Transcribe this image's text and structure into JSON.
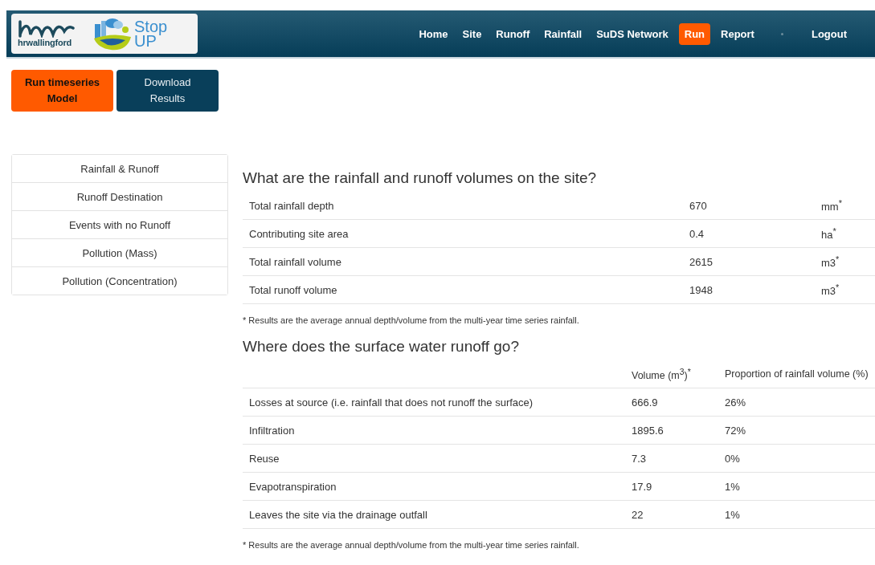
{
  "header": {
    "logo_text": "hrwallingford",
    "brand_lines": [
      "Stop",
      "UP"
    ],
    "nav": [
      {
        "label": "Home",
        "selected": false,
        "kind": "link"
      },
      {
        "label": "Site",
        "selected": false,
        "kind": "link"
      },
      {
        "label": "Runoff",
        "selected": false,
        "kind": "link"
      },
      {
        "label": "Rainfall",
        "selected": false,
        "kind": "link"
      },
      {
        "label": "SuDS Network",
        "selected": false,
        "kind": "link"
      },
      {
        "label": "Run",
        "selected": true,
        "kind": "link"
      },
      {
        "label": "Report",
        "selected": false,
        "kind": "link"
      },
      {
        "kind": "separator"
      },
      {
        "label": "Logout",
        "selected": false,
        "kind": "link"
      }
    ]
  },
  "actions": [
    {
      "label": "Run timeseries Model",
      "kind": "primary"
    },
    {
      "label": "Download Results",
      "kind": "secondary"
    }
  ],
  "sidebar": {
    "items": [
      {
        "label": "Rainfall & Runoff",
        "selected": false
      },
      {
        "label": "Runoff Destination",
        "selected": false
      },
      {
        "label": "Events with no Runoff",
        "selected": false
      },
      {
        "label": "Pollution (Mass)",
        "selected": false
      },
      {
        "label": "Pollution (Concentration)",
        "selected": false
      }
    ]
  },
  "sections": [
    {
      "title": "What are the rainfall and runoff volumes on the site?",
      "rows": [
        [
          "Total rainfall depth",
          "670",
          "mm$^{*}$"
        ],
        [
          "Contributing site area",
          "0.4",
          "ha$^{*}$"
        ],
        [
          "Total rainfall volume",
          "2615",
          "m3$^{*}$"
        ],
        [
          "Total runoff volume",
          "1948",
          "m3$^{*}$"
        ]
      ],
      "footnote": "* Results are the average annual depth/volume from the multi-year time series rainfall."
    },
    {
      "title": "Where does the surface water runoff go?",
      "columns": [
        "",
        "Volume (m$^{3}$)$^{*}$",
        "Proportion of rainfall volume (%)"
      ],
      "rows": [
        [
          "Losses at source (i.e. rainfall that does not runoff the surface)",
          "666.9",
          "26%"
        ],
        [
          "Infiltration",
          "1895.6",
          "72%"
        ],
        [
          "Reuse",
          "7.3",
          "0%"
        ],
        [
          "Evapotranspiration",
          "17.9",
          "1%"
        ],
        [
          "Leaves the site via the drainage outfall",
          "22",
          "1%"
        ]
      ],
      "footnote": "* Results are the average annual depth/volume from the multi-year time series rainfall."
    }
  ]
}
